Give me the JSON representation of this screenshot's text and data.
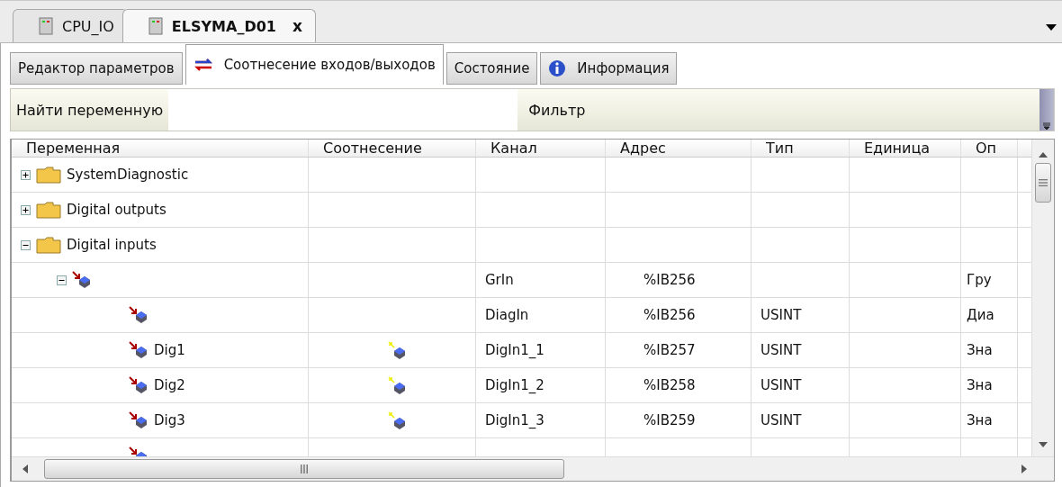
{
  "document_tabs": [
    {
      "label": "CPU_IO",
      "selected": false,
      "closable": false
    },
    {
      "label": "ELSYMA_D01",
      "selected": true,
      "closable": true,
      "close_label": "x"
    }
  ],
  "editor_tabs": [
    {
      "label": "Редактор параметров",
      "selected": false,
      "kind": "plain"
    },
    {
      "label": "Соотнесение входов/выходов",
      "selected": true,
      "kind": "mapping"
    },
    {
      "label": "Состояние",
      "selected": false,
      "kind": "plain"
    },
    {
      "label": "Информация",
      "selected": false,
      "kind": "info"
    }
  ],
  "search": {
    "label": "Найти переменную",
    "filter_label": "Фильтр"
  },
  "table": {
    "columns": [
      "Переменная",
      "Соотнесение",
      "Канал",
      "Адрес",
      "Тип",
      "Единица",
      "Оп"
    ],
    "rows": [
      {
        "kind": "folder",
        "name": "SystemDiagnostic",
        "expanded": false
      },
      {
        "kind": "folder",
        "name": "Digital outputs",
        "expanded": false
      },
      {
        "kind": "folder",
        "name": "Digital inputs",
        "expanded": true,
        "children": [
          {
            "kind": "group",
            "expanded": true,
            "channel": "GrIn",
            "address": "%IB256",
            "description": "Гру",
            "children": [
              {
                "kind": "channel",
                "mapped": false,
                "channel": "DiagIn",
                "address": "%IB256",
                "type": "USINT",
                "description": "Диа"
              },
              {
                "kind": "channel",
                "name": "Dig1",
                "mapped": true,
                "channel": "DigIn1_1",
                "address": "%IB257",
                "type": "USINT",
                "description": "Зна"
              },
              {
                "kind": "channel",
                "name": "Dig2",
                "mapped": true,
                "channel": "DigIn1_2",
                "address": "%IB258",
                "type": "USINT",
                "description": "Зна"
              },
              {
                "kind": "channel",
                "name": "Dig3",
                "mapped": true,
                "channel": "DigIn1_3",
                "address": "%IB259",
                "type": "USINT",
                "description": "Зна"
              },
              {
                "kind": "channel",
                "mapped": false
              }
            ]
          }
        ]
      }
    ]
  }
}
